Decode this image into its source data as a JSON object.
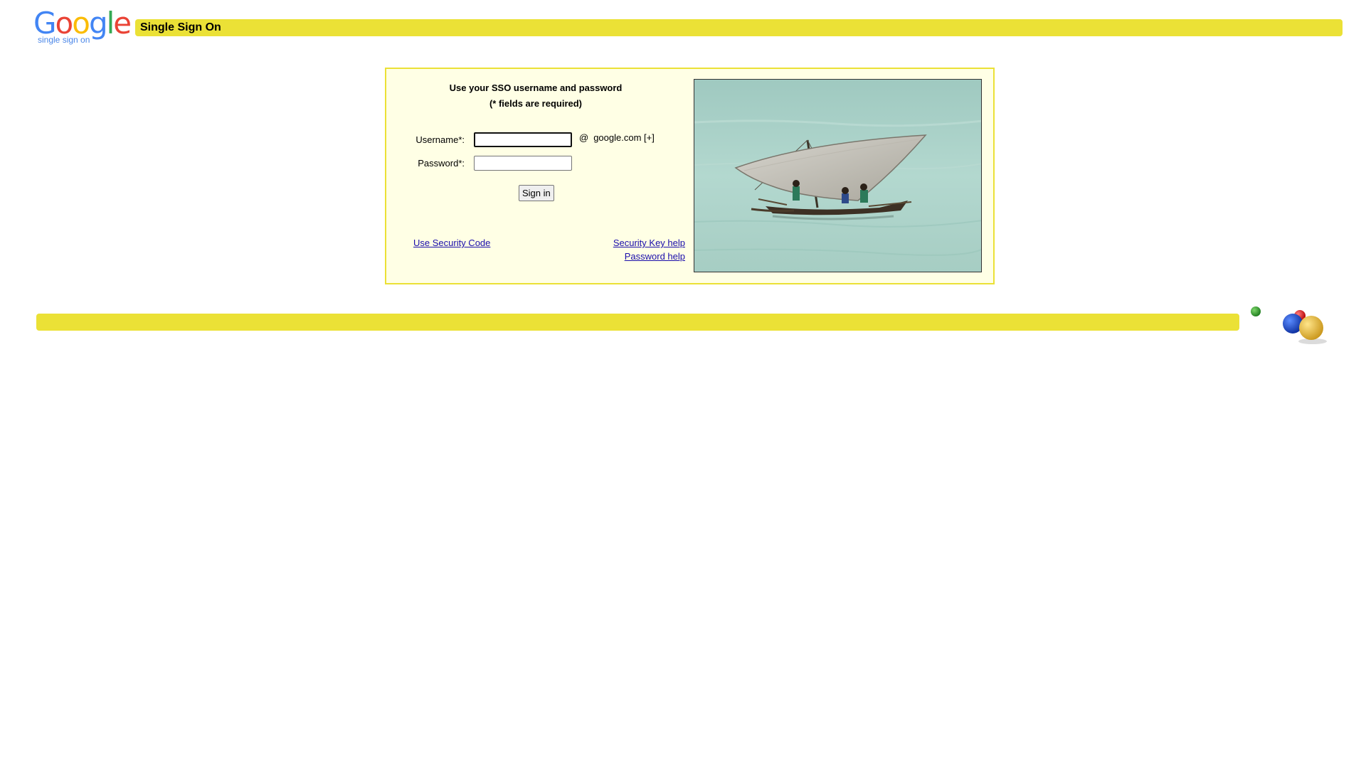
{
  "header": {
    "logo_text": "Google",
    "logo_subtitle": "single sign on",
    "title": "Single Sign On",
    "logo_colors": [
      "#4285f4",
      "#ea4335",
      "#fbbc05",
      "#4285f4",
      "#34a853",
      "#ea4335"
    ]
  },
  "form": {
    "instruction_line1": "Use your SSO username and password",
    "instruction_line2": "(* fields are required)",
    "username_label": "Username*:",
    "username_value": "",
    "password_label": "Password*:",
    "password_value": "",
    "at_sign": "@",
    "domain": "google.com [+]",
    "signin_label": "Sign in"
  },
  "links": {
    "security_code": "Use Security Code",
    "security_key_help": "Security Key help",
    "password_help": "Password help"
  },
  "colors": {
    "accent_yellow": "#ebe136",
    "panel_bg": "#ffffe5",
    "link": "#1a0dab"
  },
  "photo": {
    "icon": "sailboat-photo"
  }
}
